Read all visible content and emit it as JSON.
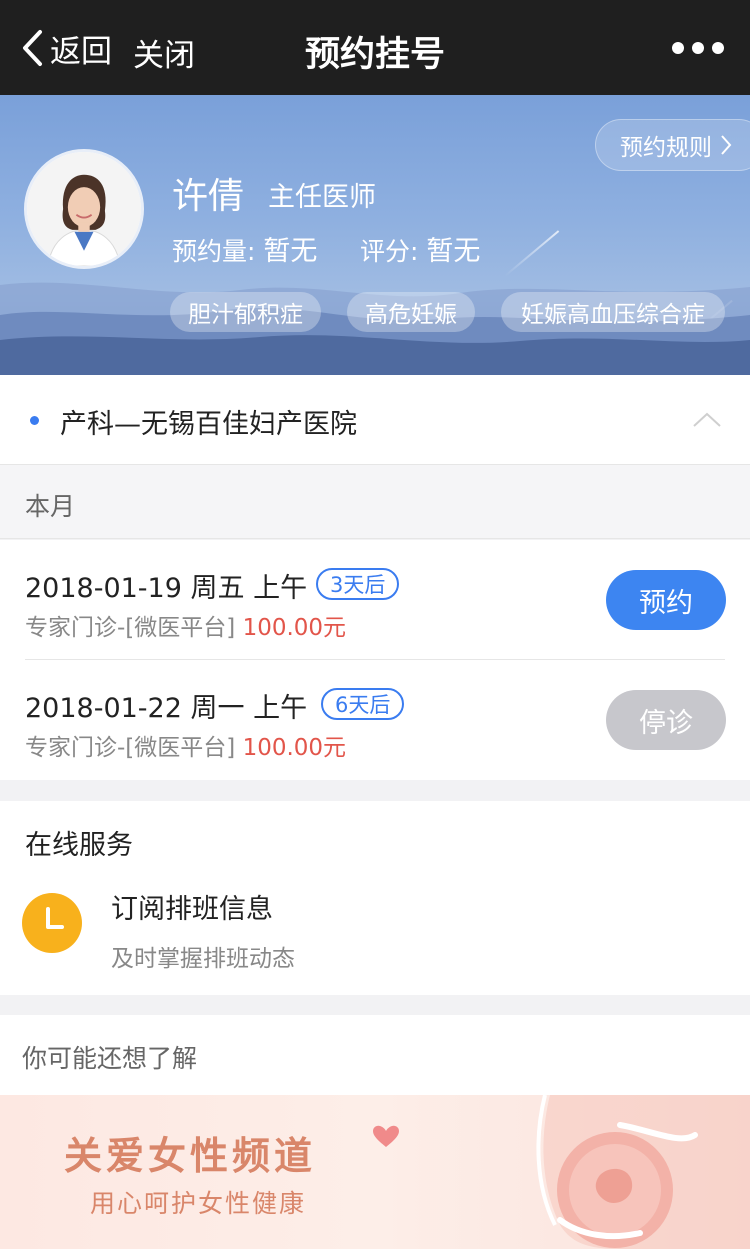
{
  "nav": {
    "back_label": "返回",
    "close_label": "关闭",
    "title": "预约挂号"
  },
  "doctor": {
    "name": "许倩",
    "title": "主任医师",
    "appointments_label": "预约量:",
    "appointments_value": "暂无",
    "rating_label": "评分:",
    "rating_value": "暂无",
    "rules_label": "预约规则",
    "tags": [
      "胆汁郁积症",
      "高危妊娠",
      "妊娠高血压综合症"
    ]
  },
  "hospital": {
    "label": "产科—无锡百佳妇产医院"
  },
  "month_label": "本月",
  "schedule": [
    {
      "date": "2018-01-19 周五  上午",
      "badge": "3天后",
      "type": "专家门诊-[微医平台]",
      "price": "100.00元",
      "button": "预约",
      "available": true
    },
    {
      "date": "2018-01-22 周一  上午",
      "badge": "6天后",
      "type": "专家门诊-[微医平台]",
      "price": "100.00元",
      "button": "停诊",
      "available": false
    }
  ],
  "online": {
    "title": "在线服务",
    "service_title": "订阅排班信息",
    "service_sub": "及时掌握排班动态"
  },
  "maybe_label": "你可能还想了解",
  "banner": {
    "title": "关爱女性频道",
    "subtitle": "用心呵护女性健康"
  },
  "colors": {
    "accent": "#3d85f1",
    "price": "#e2554a",
    "navbar": "#1f1f1f",
    "clock": "#f8b11c"
  }
}
